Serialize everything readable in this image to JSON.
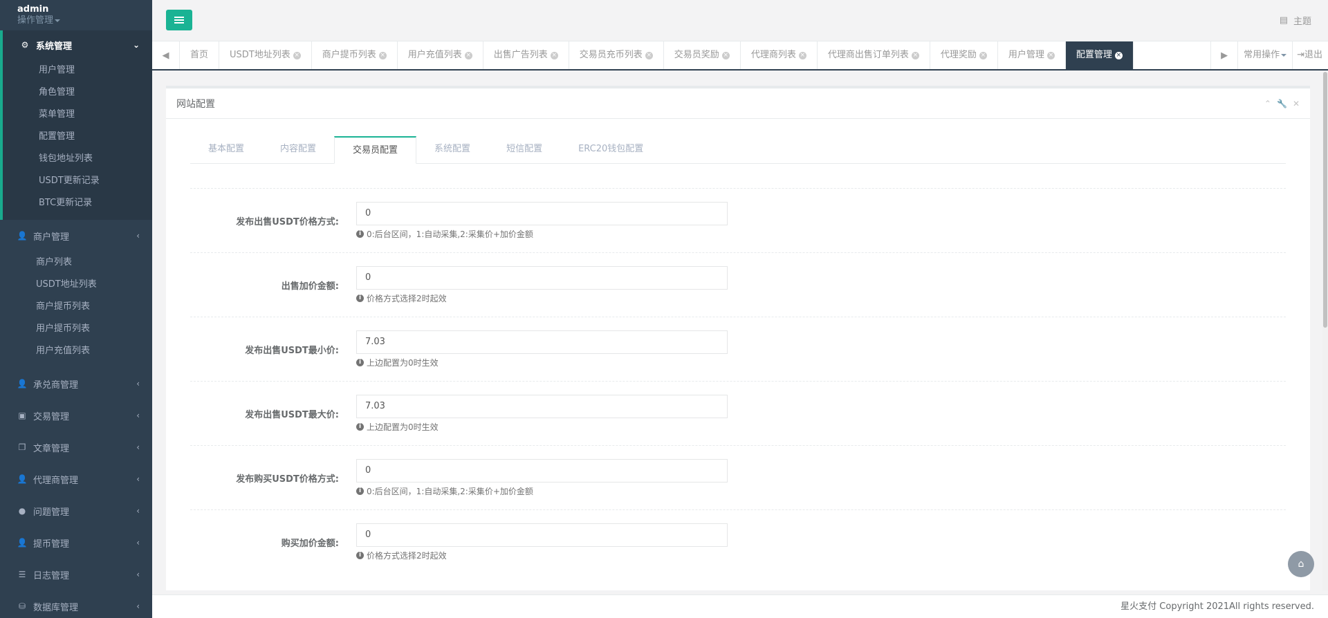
{
  "profile": {
    "name": "admin",
    "role": "操作管理"
  },
  "sidebar": {
    "groups": [
      {
        "label": "系统管理",
        "icon": "gear-icon",
        "items": [
          "用户管理",
          "角色管理",
          "菜单管理",
          "配置管理",
          "钱包地址列表",
          "USDT更新记录",
          "BTC更新记录"
        ]
      },
      {
        "label": "商户管理",
        "icon": "user-icon",
        "items": [
          "商户列表",
          "USDT地址列表",
          "商户提币列表",
          "用户提币列表",
          "用户充值列表"
        ]
      },
      {
        "label": "承兑商管理",
        "icon": "user-icon"
      },
      {
        "label": "交易管理",
        "icon": "image-icon"
      },
      {
        "label": "文章管理",
        "icon": "copy-icon"
      },
      {
        "label": "代理商管理",
        "icon": "user-icon"
      },
      {
        "label": "问题管理",
        "icon": "comment-icon"
      },
      {
        "label": "提币管理",
        "icon": "user-icon"
      },
      {
        "label": "日志管理",
        "icon": "list-icon"
      },
      {
        "label": "数据库管理",
        "icon": "database-icon"
      }
    ]
  },
  "topbar": {
    "theme_label": "主题"
  },
  "tabs": [
    "首页",
    "USDT地址列表",
    "商户提币列表",
    "用户充值列表",
    "出售广告列表",
    "交易员充币列表",
    "交易员奖励",
    "代理商列表",
    "代理商出售订单列表",
    "代理奖励",
    "用户管理",
    "配置管理"
  ],
  "tab_active": "配置管理",
  "tabbar_right": {
    "common_ops": "常用操作",
    "logout": "退出"
  },
  "panel": {
    "title": "网站配置"
  },
  "form_tabs": [
    "基本配置",
    "内容配置",
    "交易员配置",
    "系统配置",
    "短信配置",
    "ERC20钱包配置"
  ],
  "form_tab_active": "交易员配置",
  "fields": [
    {
      "label": "发布出售USDT价格方式:",
      "value": "0",
      "help": "0:后台区间，1:自动采集,2:采集价+加价金额"
    },
    {
      "label": "出售加价金额:",
      "value": "0",
      "help": "价格方式选择2时起效"
    },
    {
      "label": "发布出售USDT最小价:",
      "value": "7.03",
      "help": "上边配置为0时生效"
    },
    {
      "label": "发布出售USDT最大价:",
      "value": "7.03",
      "help": "上边配置为0时生效"
    },
    {
      "label": "发布购买USDT价格方式:",
      "value": "0",
      "help": "0:后台区间，1:自动采集,2:采集价+加价金额"
    },
    {
      "label": "购买加价金额:",
      "value": "0",
      "help": "价格方式选择2时起效"
    }
  ],
  "footer": {
    "copyright": "星火支付 Copyright 2021All rights reserved."
  },
  "colors": {
    "sidebar_bg": "#2f4050",
    "accent": "#1ab394",
    "active_tab_bg": "#2f4050"
  }
}
